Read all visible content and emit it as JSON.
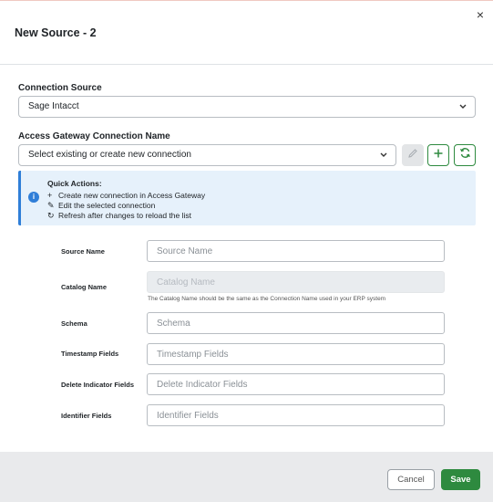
{
  "dialog": {
    "title": "New Source - 2",
    "close_glyph": "×"
  },
  "connection_source": {
    "label": "Connection Source",
    "value": "Sage Intacct"
  },
  "gateway": {
    "label": "Access Gateway Connection Name",
    "placeholder": "Select existing or create new connection",
    "edit_icon": "pencil-icon",
    "add_icon": "plus-icon",
    "refresh_icon": "refresh-icon"
  },
  "quick_actions": {
    "title": "Quick Actions:",
    "items": [
      {
        "glyph": "+",
        "text": "Create new connection in Access Gateway"
      },
      {
        "glyph": "✎",
        "text": "Edit the selected connection"
      },
      {
        "glyph": "↻",
        "text": "Refresh after changes to reload the list"
      }
    ],
    "info_glyph": "i"
  },
  "fields": {
    "source_name": {
      "label": "Source Name",
      "placeholder": "Source Name"
    },
    "catalog_name": {
      "label": "Catalog Name",
      "placeholder": "Catalog Name",
      "help": "The Catalog Name should be the same as the Connection Name used in your ERP system"
    },
    "schema": {
      "label": "Schema",
      "placeholder": "Schema"
    },
    "timestamp_fields": {
      "label": "Timestamp Fields",
      "placeholder": "Timestamp Fields"
    },
    "delete_indicator_fields": {
      "label": "Delete Indicator Fields",
      "placeholder": "Delete Indicator Fields"
    },
    "identifier_fields": {
      "label": "Identifier Fields",
      "placeholder": "Identifier Fields"
    }
  },
  "footer": {
    "cancel_label": "Cancel",
    "save_label": "Save"
  },
  "colors": {
    "accent_green": "#2e8a3f",
    "info_blue": "#2f7ed8",
    "info_bg": "#e6f1fb"
  }
}
